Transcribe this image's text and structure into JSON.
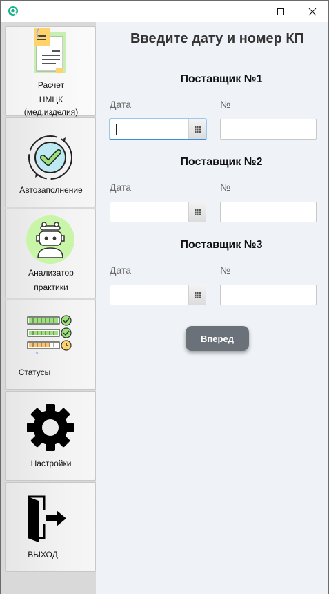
{
  "window": {
    "icon": "q-app-icon",
    "controls": [
      "minimize-icon",
      "maximize-icon",
      "close-icon"
    ]
  },
  "sidebar": {
    "items": [
      {
        "label": "Расчет\nНМЦК\n(мед.изделия)",
        "lines": [
          "Расчет",
          "НМЦК",
          "(мед.изделия)"
        ],
        "icon": "document-calculator-icon"
      },
      {
        "label": "Автозаполнение",
        "icon": "checkmark-cycle-icon"
      },
      {
        "label": "Анализатор\nпрактики",
        "lines": [
          "Анализатор",
          "практики"
        ],
        "icon": "robot-icon"
      },
      {
        "label": "Статусы",
        "icon": "status-bars-icon"
      },
      {
        "label": "Настройки",
        "icon": "gear-icon"
      },
      {
        "label": "ВЫХОД",
        "icon": "exit-door-icon"
      }
    ]
  },
  "main": {
    "title": "Введите дату и номер КП",
    "suppliers": [
      {
        "title": "Поставщик №1",
        "date_label": "Дата",
        "number_label": "№",
        "date_value": "",
        "number_value": ""
      },
      {
        "title": "Поставщик №2",
        "date_label": "Дата",
        "number_label": "№",
        "date_value": "",
        "number_value": ""
      },
      {
        "title": "Поставщик №3",
        "date_label": "Дата",
        "number_label": "№",
        "date_value": "",
        "number_value": ""
      }
    ],
    "next_button": "Вперед"
  },
  "colors": {
    "content_bg": "#eff2f6",
    "sidebar_bg": "#d9d9d9",
    "button_bg": "#6b7178",
    "focus_border": "#3a8fd8",
    "accent_green": "#9be27a"
  }
}
